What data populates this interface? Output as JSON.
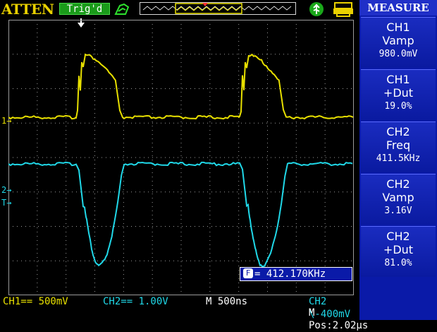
{
  "status_bar": {
    "brand": "ATTEN",
    "trigger_status": "Trig'd"
  },
  "colors": {
    "ch1": "#e8e000",
    "ch2": "#20d8e8",
    "menu_bg": "#0a1aa8",
    "grid": "#9a9a9a"
  },
  "icons": {
    "run": "run-icon",
    "usb": "usb-icon",
    "printer": "printer-icon",
    "trigger_pos": "trigger-position-arrow-icon"
  },
  "markers": {
    "ch1": "1",
    "ch2": "2",
    "trigger": "T"
  },
  "menu": {
    "title": "MEASURE",
    "items": [
      {
        "channel": "CH1",
        "name": "Vamp",
        "value": "980.0mV"
      },
      {
        "channel": "CH1",
        "name": "+Dut",
        "value": "19.0%"
      },
      {
        "channel": "CH2",
        "name": "Freq",
        "value": "411.5KHz"
      },
      {
        "channel": "CH2",
        "name": "Vamp",
        "value": "3.16V"
      },
      {
        "channel": "CH2",
        "name": "+Dut",
        "value": "81.0%"
      }
    ]
  },
  "readout": {
    "freq_counter": "= 412.170KHz"
  },
  "bottom": {
    "ch1_scale": "CH1== 500mV",
    "ch2_scale": "CH2== 1.00V",
    "timebase": "M 500ns",
    "trigger_info": "CH2 \\-400mV",
    "m_pos": "M Pos:2.02µs"
  }
}
